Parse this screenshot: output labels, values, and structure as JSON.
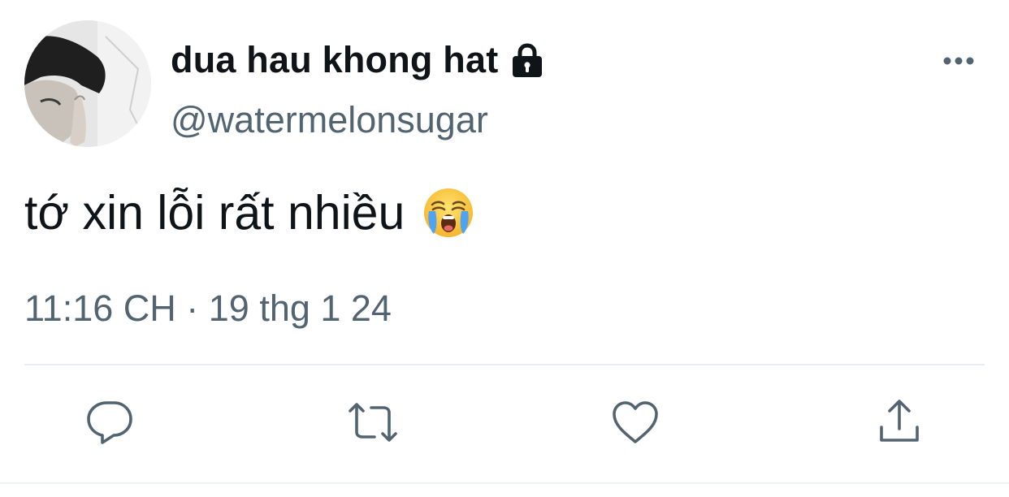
{
  "user": {
    "display_name": "dua hau khong hat",
    "handle": "@watermelonsugar",
    "avatar_icon": "avatar-photo",
    "protected_icon": "lock-icon"
  },
  "tweet": {
    "text": "tớ xin lỗi rất nhiều",
    "emoji_icon": "loudly-crying-face-emoji",
    "timestamp": "11:16 CH · 19 thg 1 24"
  },
  "actions": [
    {
      "name": "reply",
      "icon": "reply-icon"
    },
    {
      "name": "retweet",
      "icon": "retweet-icon"
    },
    {
      "name": "like",
      "icon": "heart-icon"
    },
    {
      "name": "share",
      "icon": "share-icon"
    }
  ],
  "colors": {
    "text": "#0f1419",
    "secondary": "#536471",
    "divider": "#e6ecf0"
  }
}
